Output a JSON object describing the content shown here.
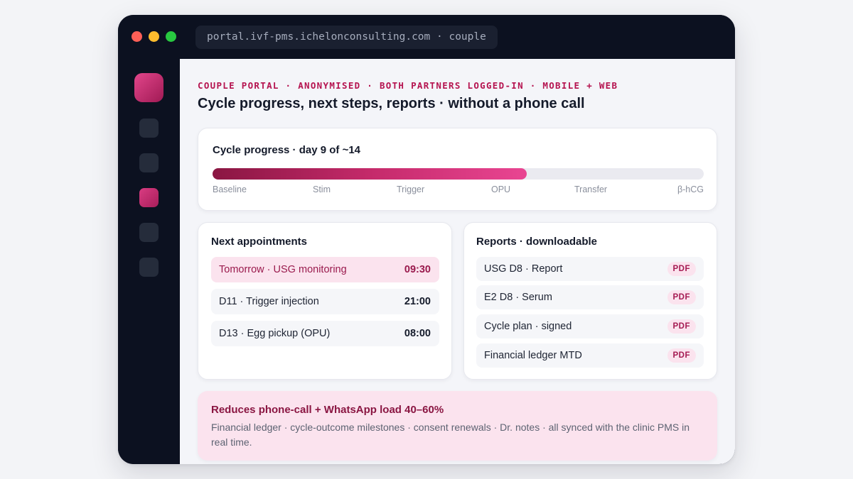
{
  "window": {
    "url": "portal.ivf-pms.ichelonconsulting.com · couple"
  },
  "header": {
    "eyebrow": "COUPLE PORTAL · ANONYMISED · BOTH PARTNERS LOGGED-IN · MOBILE + WEB",
    "title": "Cycle progress, next steps, reports · without a phone call"
  },
  "progress": {
    "title": "Cycle progress · day 9 of ~14",
    "fill_fraction": 0.64,
    "stages": [
      "Baseline",
      "Stim",
      "Trigger",
      "OPU",
      "Transfer",
      "β-hCG"
    ]
  },
  "appointments": {
    "title": "Next appointments",
    "items": [
      {
        "label": "Tomorrow · USG monitoring",
        "time": "09:30",
        "highlight": true
      },
      {
        "label": "D11 · Trigger injection",
        "time": "21:00",
        "highlight": false
      },
      {
        "label": "D13 · Egg pickup (OPU)",
        "time": "08:00",
        "highlight": false
      }
    ]
  },
  "reports": {
    "title": "Reports · downloadable",
    "items": [
      {
        "label": "USG D8 · Report",
        "badge": "PDF"
      },
      {
        "label": "E2 D8 · Serum",
        "badge": "PDF"
      },
      {
        "label": "Cycle plan · signed",
        "badge": "PDF"
      },
      {
        "label": "Financial ledger MTD",
        "badge": "PDF"
      }
    ]
  },
  "callout": {
    "title": "Reduces phone-call + WhatsApp load 40–60%",
    "body": "Financial ledger · cycle-outcome milestones · consent renewals · Dr. notes · all synced with the clinic PMS in real time."
  },
  "colors": {
    "accent": "#c42a6a",
    "accent_dark": "#8a1642",
    "sidebar": "#0c1120"
  }
}
